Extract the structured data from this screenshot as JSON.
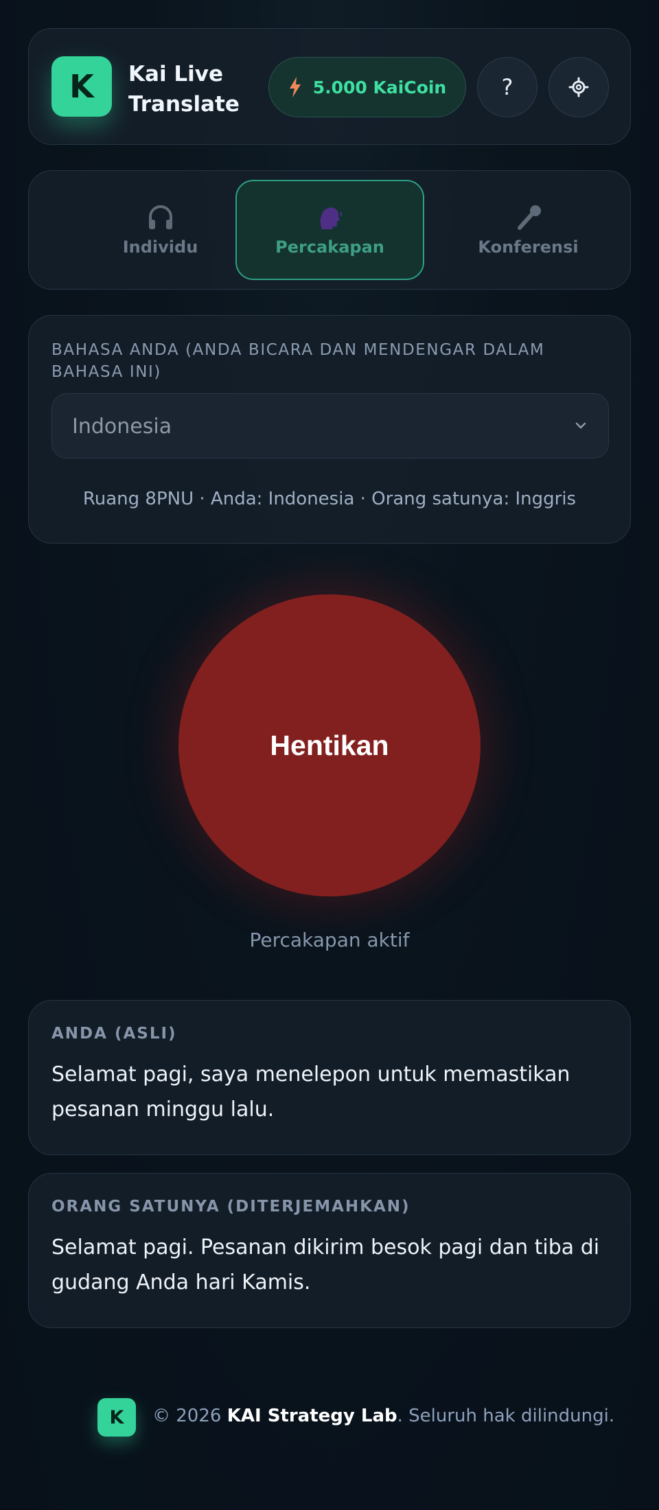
{
  "header": {
    "logo_letter": "K",
    "app_title": "Kai Live Translate",
    "coin_balance": "5.000 KaiCoin",
    "help_label": "?",
    "icons": {
      "coin": "lightning-bolt-icon",
      "settings": "gear-icon"
    }
  },
  "modes": {
    "items": [
      {
        "label": "Individu",
        "icon": "headphones-icon"
      },
      {
        "label": "Percakapan",
        "icon": "speaking-head-icon"
      },
      {
        "label": "Konferensi",
        "icon": "microphone-icon"
      }
    ],
    "active_index": 1
  },
  "language": {
    "label": "BAHASA ANDA (ANDA BICARA DAN MENDENGAR DALAM BAHASA INI)",
    "selected": "Indonesia",
    "room_info": "Ruang 8PNU · Anda: Indonesia · Orang satunya: Inggris"
  },
  "control": {
    "stop_label": "Hentikan",
    "status": "Percakapan aktif"
  },
  "transcript": {
    "you_label": "ANDA (ASLI)",
    "you_text": "Selamat pagi, saya menelepon untuk memastikan pesanan minggu lalu.",
    "other_label": "ORANG SATUNYA (DITERJEMAHKAN)",
    "other_text": "Selamat pagi. Pesanan dikirim besok pagi dan tiba di gudang Anda hari Kamis."
  },
  "footer": {
    "logo_letter": "K",
    "copyright": "© 2026 ",
    "brand": "KAI Strategy Lab",
    "rights": ". Seluruh hak dilindungi."
  },
  "colors": {
    "accent": "#34d399",
    "coin_text": "#3ee0a2",
    "stop": "#82201f",
    "background": "#0a141d"
  }
}
